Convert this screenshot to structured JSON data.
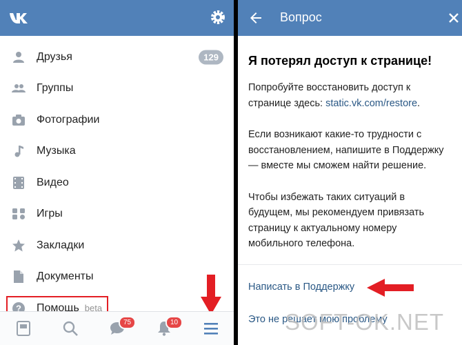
{
  "left": {
    "menu": [
      {
        "label": "Друзья",
        "icon": "person-icon",
        "count": "129"
      },
      {
        "label": "Группы",
        "icon": "groups-icon"
      },
      {
        "label": "Фотографии",
        "icon": "camera-icon"
      },
      {
        "label": "Музыка",
        "icon": "music-note-icon"
      },
      {
        "label": "Видео",
        "icon": "video-icon"
      },
      {
        "label": "Игры",
        "icon": "gamepad-icon"
      },
      {
        "label": "Закладки",
        "icon": "star-icon"
      },
      {
        "label": "Документы",
        "icon": "document-icon"
      },
      {
        "label": "Помощь",
        "icon": "help-icon",
        "tag": "beta"
      }
    ],
    "tabbar": {
      "messages_badge": "75",
      "notifications_badge": "10"
    }
  },
  "right": {
    "header_title": "Вопрос",
    "question_title": "Я потерял доступ к странице!",
    "para1_text": "Попробуйте восстановить доступ к странице здесь: ",
    "para1_link": "static.vk.com/restore",
    "para1_end": ".",
    "para2": "Если возникают какие-то трудности с восстановлением, напишите в Поддержку — вместе мы сможем найти решение.",
    "para3": "Чтобы избежать таких ситуаций в будущем, мы рекомендуем привязать страницу к актуальному номеру мобильного телефона.",
    "support_link": "Написать в Поддержку",
    "other_link": "Это не решает мою проблему"
  },
  "watermark": "SOFT-OK.NET",
  "colors": {
    "header": "#5181b8",
    "accent": "#e31e24",
    "link": "#2a5885"
  }
}
